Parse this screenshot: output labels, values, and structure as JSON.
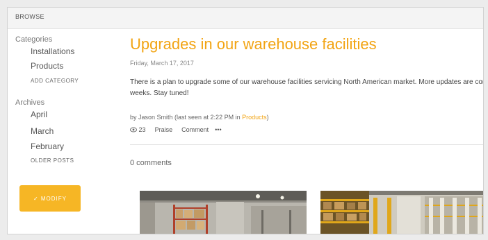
{
  "topbar": {
    "label": "BROWSE"
  },
  "sidebar": {
    "categories_heading": "Categories",
    "categories": [
      "Installations",
      "Products"
    ],
    "add_category": "ADD CATEGORY",
    "archives_heading": "Archives",
    "archives": [
      "April",
      "March",
      "February"
    ],
    "older_posts": "OLDER POSTS",
    "modify_button": "✓ MODIFY"
  },
  "post": {
    "title": "Upgrades in our warehouse facilities",
    "date": "Friday, March 17, 2017",
    "body": "There is a plan to upgrade some of our warehouse facilities servicing North American market. More updates are coming in a next few weeks. Stay tuned!",
    "byline_prefix": "by Jason Smith (last seen at 2:22 PM in ",
    "byline_category": "Products",
    "byline_suffix": ")",
    "views": "23",
    "praise_label": "Praise",
    "comment_label": "Comment",
    "more_label": "•••",
    "comments_count": "0 comments"
  },
  "icons": {
    "views": "eye-icon",
    "more": "more-dots-icon",
    "modify": "check-icon"
  },
  "colors": {
    "accent": "#f2a413",
    "button": "#f6b625"
  }
}
